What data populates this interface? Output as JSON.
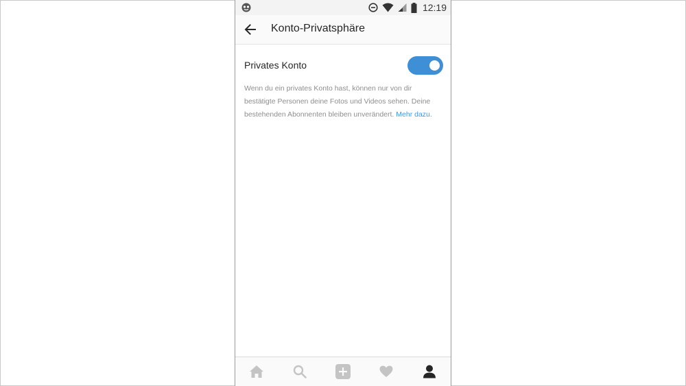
{
  "status_bar": {
    "time": "12:19",
    "icons": [
      "app-notification-icon",
      "data-saver-icon",
      "wifi-icon",
      "signal-icon",
      "battery-icon"
    ]
  },
  "header": {
    "title": "Konto-Privatsphäre",
    "back_icon": "arrow-left-icon"
  },
  "setting": {
    "label": "Privates Konto",
    "toggle_on": true,
    "description": "Wenn du ein privates Konto hast, können nur von dir bestätigte Personen deine Fotos und Videos sehen. Deine bestehenden Abonnenten bleiben unverändert.",
    "learn_more": "Mehr dazu."
  },
  "bottom_nav": {
    "items": [
      "home-icon",
      "search-icon",
      "add-post-icon",
      "heart-icon",
      "profile-icon"
    ],
    "active": "profile-icon"
  },
  "colors": {
    "accent": "#3897f0",
    "toggle": "#3f8fd6",
    "text": "#262626",
    "muted": "#8e8e8e",
    "nav_inactive": "#c4c4c4"
  }
}
